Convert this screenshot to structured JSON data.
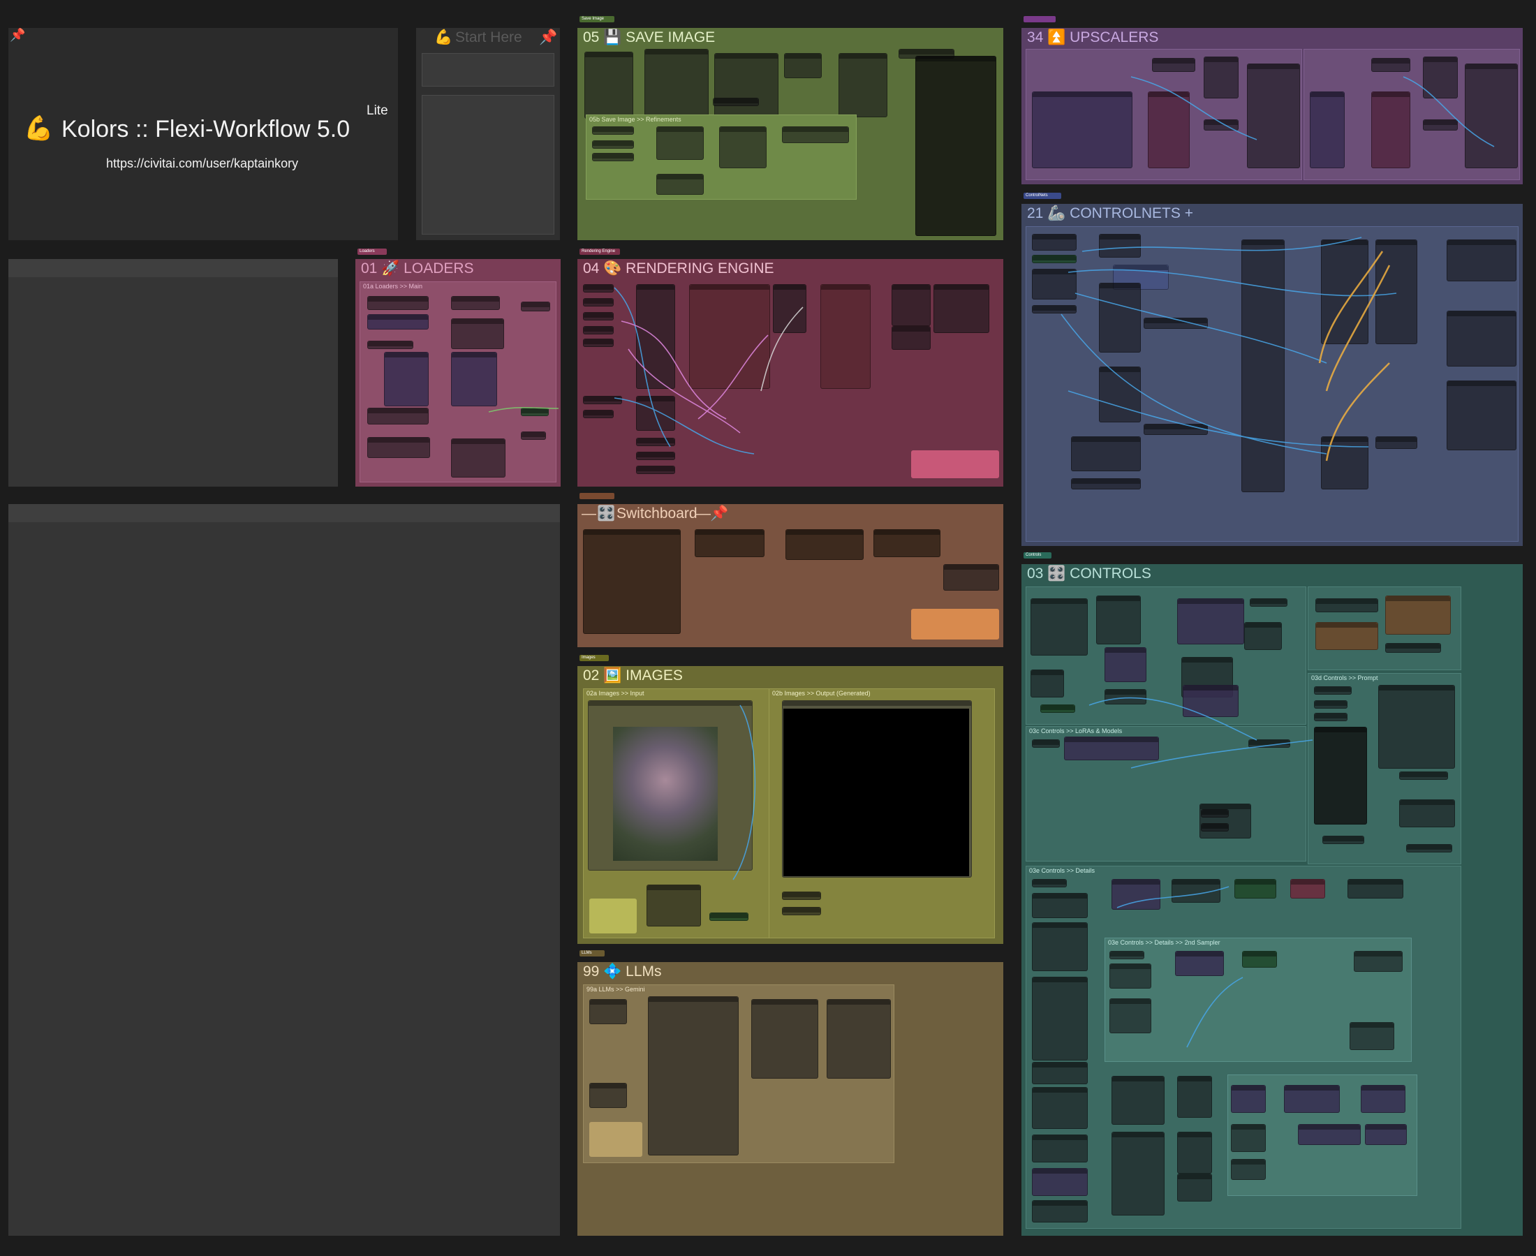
{
  "colors": {
    "canvas": "#1c1c1c",
    "save_image": "#5a6f3a",
    "upscalers": "#5a3f66",
    "controlnets": "#3e4660",
    "loaders": "#7a3d56",
    "rendering_engine": "#6e3347",
    "switchboard": "#7a5340",
    "images": "#6b6b33",
    "controls": "#2f5a52",
    "llms": "#6e5f3e",
    "wire_blue": "#48a6e8",
    "wire_orange": "#f0b040",
    "wire_pink": "#e088e0",
    "wire_green": "#7ecb6c"
  },
  "title_card": {
    "icon": "💪",
    "title": "Kolors :: Flexi-Workflow 5.0",
    "badge": "Lite",
    "url": "https://civitai.com/user/kaptainkory",
    "pin": "📌"
  },
  "start_here": {
    "title": "Start Here",
    "pin": "📌"
  },
  "groups": {
    "save_image": {
      "title": "05 💾 SAVE IMAGE",
      "tag": "Save Image",
      "sub": "05b Save Image >> Refinements"
    },
    "upscalers": {
      "title": "34 ⏫ UPSCALERS"
    },
    "controlnets": {
      "title": "21 🦾 CONTROLNETS +",
      "tag": "ControlNets"
    },
    "loaders": {
      "title": "01 🚀 LOADERS",
      "tag": "Loaders",
      "sub": "01a Loaders >> Main"
    },
    "rendering": {
      "title": "04 🎨 RENDERING ENGINE",
      "tag": "Rendering Engine"
    },
    "switchboard": {
      "title": "Switchboard",
      "icon": "🎛️",
      "pin": "📌"
    },
    "images": {
      "title": "02 🖼️ IMAGES",
      "tag": "Images",
      "sub_input": "02a Images >> Input",
      "sub_output": "02b Images >> Output (Generated)"
    },
    "controls": {
      "title": "03 🎛️ CONTROLS",
      "tag": "Controls",
      "sub_lora": "03c Controls >> LoRAs & Models",
      "sub_prompt": "03d Controls >> Prompt",
      "sub_details": "03e Controls >> Details",
      "sub_2nd": "03e Controls >> Details >> 2nd Sampler"
    },
    "llms": {
      "title": "99 💠 LLMs",
      "tag": "LLMs",
      "sub": "99a LLMs >> Gemini"
    }
  }
}
